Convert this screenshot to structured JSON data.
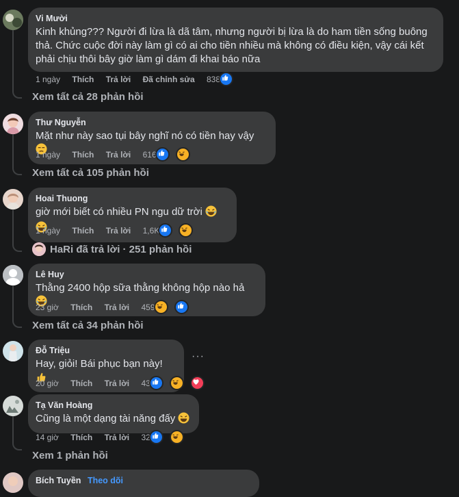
{
  "comments": [
    {
      "author": "Vi Mười",
      "text_lines": [
        "Kinh khủng??? Người đi lừa là dã tâm, nhưng người bị lừa là do ham tiền sống buông",
        "thả. Chức cuộc đời này làm gì có ai cho tiền nhiều mà không có điều kiện, vậy cái kết",
        "phải chịu thôi bây giờ làm gì dám đi khai báo nữa"
      ],
      "time": "1 ngày",
      "like": "Thích",
      "reply": "Trả lời",
      "edited": "Đã chỉnh sửa",
      "reactions": "838",
      "view_replies": "Xem tất cả 28 phản hồi"
    },
    {
      "author": "Thư Nguyễn",
      "text": "Mặt như này sao tụi bây nghĩ nó có tiền hay vậy",
      "time": "1 ngày",
      "like": "Thích",
      "reply": "Trả lời",
      "reactions": "616",
      "view_replies": "Xem tất cả 105 phản hồi"
    },
    {
      "author": "Hoai Thuong",
      "text": "giờ mới biết có nhiều PN ngu dữ trời",
      "time": "1 ngày",
      "like": "Thích",
      "reply": "Trả lời",
      "reactions": "1,6K",
      "view_replies": "HaRi đã trả lời · 251 phản hồi"
    },
    {
      "author": "Lê Huy",
      "text": "Thằng 2400 hộp sữa thằng không hộp nào hả",
      "time": "23 giờ",
      "like": "Thích",
      "reply": "Trả lời",
      "reactions": "459",
      "view_replies": "Xem tất cả 34 phản hồi"
    },
    {
      "author": "Đỗ Triệu",
      "text": "Hay, giỏi! Bái phục bạn này!",
      "time": "20 giờ",
      "like": "Thích",
      "reply": "Trả lời",
      "reactions": "43"
    },
    {
      "author": "Tạ Văn Hoàng",
      "text": "Cũng là một dạng tài năng đấy",
      "time": "14 giờ",
      "like": "Thích",
      "reply": "Trả lời",
      "reactions": "32",
      "view_replies": "Xem 1 phản hồi"
    },
    {
      "author": "Bích Tuyền",
      "follow": "Theo dõi"
    }
  ],
  "more_options": "···",
  "colors": {
    "background": "#18191a",
    "bubble": "#3a3b3c",
    "like_blue": "#1877f2",
    "haha_yellow": "#f7b125",
    "love_red": "#f33e58"
  }
}
